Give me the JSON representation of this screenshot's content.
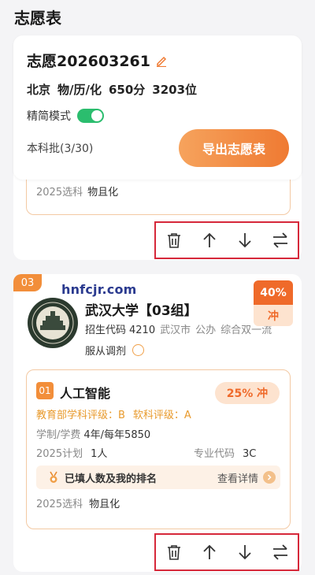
{
  "page": {
    "title": "志愿表"
  },
  "plan": {
    "name": "志愿202603261",
    "province": "北京",
    "subjects": "物/历/化",
    "score": "650分",
    "rank": "3203位",
    "mode_label": "精简模式",
    "mode_on": true,
    "batch": "本科批(3/30)",
    "export_label": "导出志愿表"
  },
  "card2": {
    "sel_label": "2025选科",
    "sel_value": "物且化"
  },
  "card3": {
    "order": "03",
    "watermark": "hnfcjr.com",
    "university": "武汉大学【03组】",
    "code_label": "招生代码",
    "code": "4210",
    "city": "武汉市",
    "type": "公办",
    "tag": "综合双一流",
    "adjust_label": "服从调剂",
    "prob": "40%",
    "prob_tag": "冲",
    "major": {
      "index": "01",
      "name": "人工智能",
      "prob": "25%  冲",
      "eval1": "教育部学科评级：B",
      "eval2": "软科评级：A",
      "tuition_label": "学制/学费",
      "tuition": "4年/每年5850",
      "plan_label": "2025计划",
      "plan": "1人",
      "code_label": "专业代码",
      "code": "3C",
      "rank_text": "已填人数及我的排名",
      "detail": "查看详情",
      "sel_label": "2025选科",
      "sel_value": "物且化"
    }
  },
  "colors": {
    "accent": "#ef7a32",
    "toggle": "#2bbd6e",
    "highlight_border": "#d6283a"
  }
}
